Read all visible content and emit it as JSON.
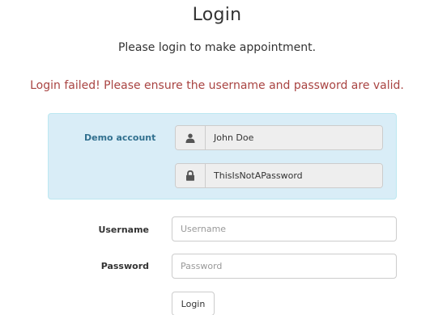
{
  "header": {
    "title": "Login",
    "subtitle": "Please login to make appointment."
  },
  "alert": {
    "message": "Login failed! Please ensure the username and password are valid.",
    "color": "#a94442"
  },
  "demo": {
    "label": "Demo account",
    "username": "John Doe",
    "password": "ThisIsNotAPassword",
    "username_icon": "user-icon",
    "password_icon": "lock-icon",
    "background": "#d9edf7",
    "label_color": "#31708f"
  },
  "form": {
    "username_label": "Username",
    "username_placeholder": "Username",
    "password_label": "Password",
    "password_placeholder": "Password",
    "submit_label": "Login"
  }
}
